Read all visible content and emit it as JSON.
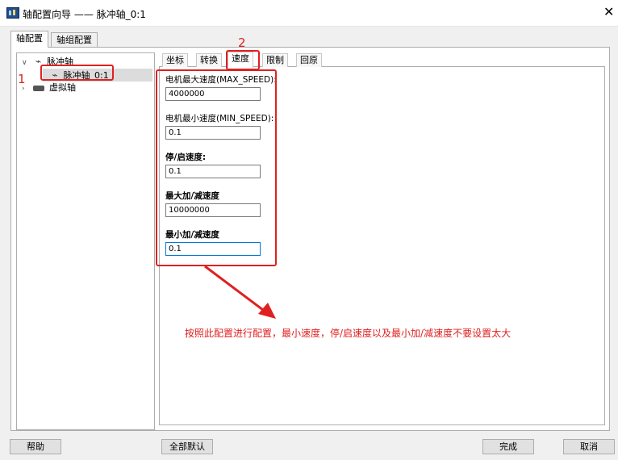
{
  "window": {
    "title": "轴配置向导 —— 脉冲轴_0:1",
    "close_glyph": "✕"
  },
  "outer_tabs": [
    "轴配置",
    "轴组配置"
  ],
  "tree": {
    "root_label": "脉冲轴",
    "child_label": "脉冲轴_0:1",
    "virtual_label": "虚拟轴",
    "expanded_glyph": "∨",
    "collapsed_glyph": "›",
    "pulse_glyph": "⌁"
  },
  "inner_tabs": [
    "坐标",
    "转换",
    "速度",
    "限制",
    "回原"
  ],
  "fields": [
    {
      "label": "电机最大速度(MAX_SPEED):",
      "value": "4000000"
    },
    {
      "label": "电机最小速度(MIN_SPEED):",
      "value": "0.1"
    },
    {
      "label": "停/启速度:",
      "value": "0.1"
    },
    {
      "label": "最大加/减速度",
      "value": "10000000"
    },
    {
      "label": "最小加/减速度",
      "value": "0.1"
    }
  ],
  "annotations": {
    "marker1": "1",
    "marker2": "2",
    "note": "按照此配置进行配置，最小速度，停/启速度以及最小加/减速度不要设置太大",
    "accent_color": "#e02020"
  },
  "buttons": {
    "help": "帮助",
    "defaults": "全部默认",
    "finish": "完成",
    "cancel": "取消"
  }
}
